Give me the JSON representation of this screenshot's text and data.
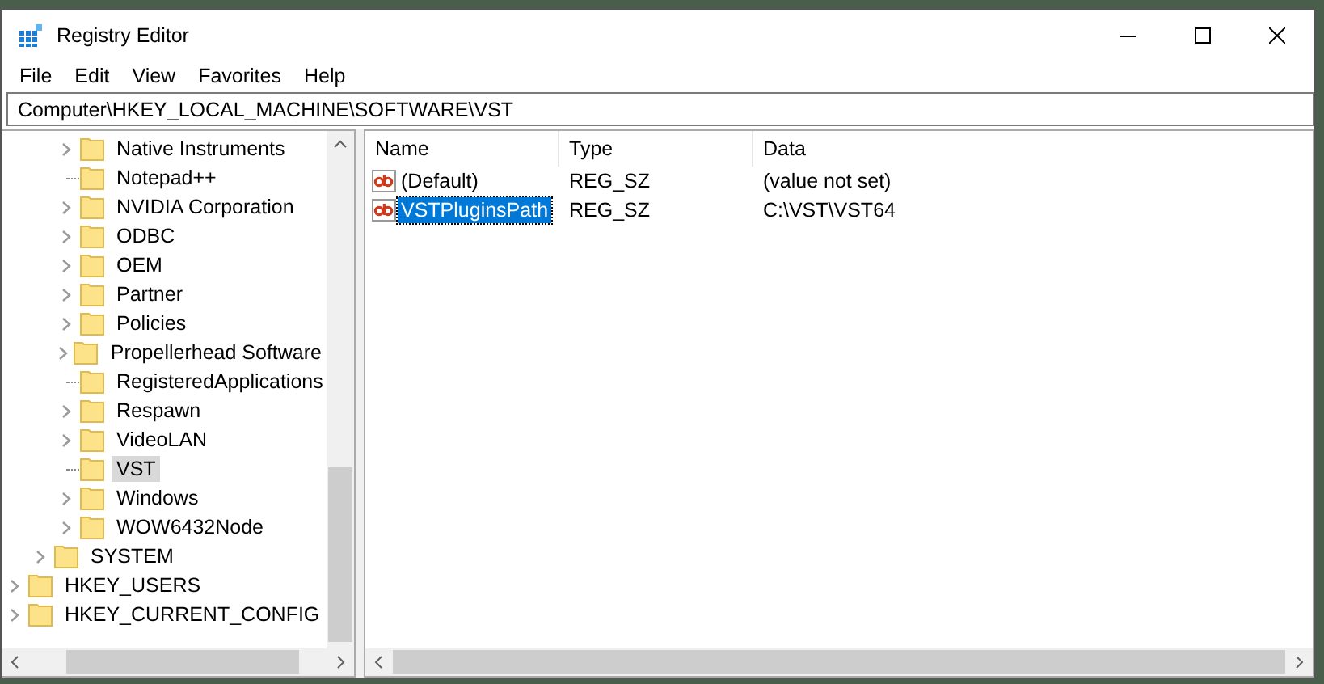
{
  "window": {
    "title": "Registry Editor"
  },
  "menu": [
    "File",
    "Edit",
    "View",
    "Favorites",
    "Help"
  ],
  "address": "Computer\\HKEY_LOCAL_MACHINE\\SOFTWARE\\VST",
  "tree": {
    "items": [
      {
        "children": [
          {
            "children": [
              {
                "label": "Native Instruments",
                "has_children": true,
                "selected": false
              },
              {
                "label": "Notepad++",
                "has_children": false,
                "selected": false
              },
              {
                "label": "NVIDIA Corporation",
                "has_children": true,
                "selected": false
              },
              {
                "label": "ODBC",
                "has_children": true,
                "selected": false
              },
              {
                "label": "OEM",
                "has_children": true,
                "selected": false
              },
              {
                "label": "Partner",
                "has_children": true,
                "selected": false
              },
              {
                "label": "Policies",
                "has_children": true,
                "selected": false
              },
              {
                "label": "Propellerhead Software",
                "has_children": true,
                "selected": false
              },
              {
                "label": "RegisteredApplications",
                "has_children": false,
                "selected": false
              },
              {
                "label": "Respawn",
                "has_children": true,
                "selected": false
              },
              {
                "label": "VideoLAN",
                "has_children": true,
                "selected": false
              },
              {
                "label": "VST",
                "has_children": false,
                "selected": true
              },
              {
                "label": "Windows",
                "has_children": true,
                "selected": false
              },
              {
                "label": "WOW6432Node",
                "has_children": true,
                "selected": false
              }
            ]
          },
          {
            "label": "SYSTEM",
            "has_children": true,
            "selected": false
          }
        ]
      },
      {
        "label": "HKEY_USERS",
        "has_children": true,
        "selected": false
      },
      {
        "label": "HKEY_CURRENT_CONFIG",
        "has_children": true,
        "selected": false
      }
    ]
  },
  "table": {
    "columns": [
      "Name",
      "Type",
      "Data"
    ],
    "rows": [
      {
        "name": "(Default)",
        "type": "REG_SZ",
        "data": "(value not set)",
        "selected": false
      },
      {
        "name": "VSTPluginsPath",
        "type": "REG_SZ",
        "data": "C:\\VST\\VST64",
        "selected": true
      }
    ]
  }
}
